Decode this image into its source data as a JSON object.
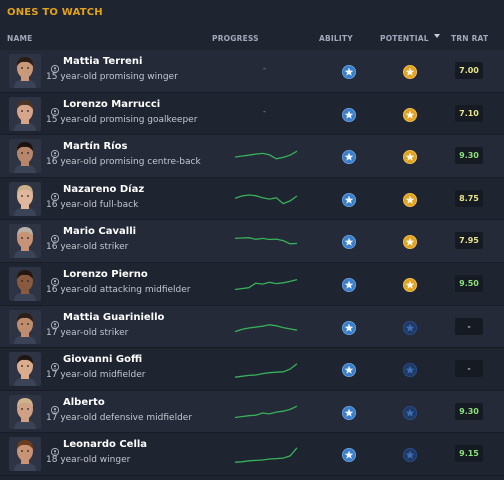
{
  "panel": {
    "title": "ONES TO WATCH"
  },
  "columns": {
    "name": "NAME",
    "progress": "PROGRESS",
    "ability": "ABILITY",
    "potential": "POTENTIAL",
    "trn_rat": "TRN RAT"
  },
  "colors": {
    "title": "#e2a21b",
    "ability_star_bg": "#3a7ec9",
    "potential_gold_bg": "#e0a322",
    "potential_dark_bg": "#203a66",
    "sparkline": "#37b15a"
  },
  "players": [
    {
      "name": "Mattia Terreni",
      "desc": "15 year-old promising winger",
      "progress_text": "-",
      "progress": null,
      "ability": "star-icon",
      "potential": "gold-star-icon",
      "trn_rat": "7.00",
      "trn_color": "yellow"
    },
    {
      "name": "Lorenzo Marrucci",
      "desc": "15 year-old promising goalkeeper",
      "progress_text": "-",
      "progress": null,
      "ability": "star-icon",
      "potential": "gold-star-icon",
      "trn_rat": "7.10",
      "trn_color": "yellow"
    },
    {
      "name": "Martín Ríos",
      "desc": "16 year-old promising centre-back",
      "progress_text": "",
      "progress": [
        0.5,
        0.55,
        0.6,
        0.66,
        0.7,
        0.62,
        0.4,
        0.48,
        0.6,
        0.82
      ],
      "ability": "star-icon",
      "potential": "gold-star-icon",
      "trn_rat": "9.30",
      "trn_color": "green"
    },
    {
      "name": "Nazareno Díaz",
      "desc": "16 year-old full-back",
      "progress_text": "",
      "progress": [
        0.6,
        0.72,
        0.78,
        0.74,
        0.62,
        0.55,
        0.62,
        0.3,
        0.45,
        0.72
      ],
      "ability": "star-icon",
      "potential": "gold-star-icon",
      "trn_rat": "8.75",
      "trn_color": "yellow"
    },
    {
      "name": "Mario Cavalli",
      "desc": "16 year-old striker",
      "progress_text": "",
      "progress": [
        0.7,
        0.72,
        0.74,
        0.65,
        0.7,
        0.64,
        0.66,
        0.58,
        0.4,
        0.42
      ],
      "ability": "star-icon",
      "potential": "gold-star-icon",
      "trn_rat": "7.95",
      "trn_color": "yellow"
    },
    {
      "name": "Lorenzo Pierno",
      "desc": "16 year-old attacking midfielder",
      "progress_text": "",
      "progress": [
        0.25,
        0.3,
        0.35,
        0.6,
        0.55,
        0.65,
        0.58,
        0.62,
        0.7,
        0.8
      ],
      "ability": "star-icon",
      "potential": "gold-star-icon",
      "trn_rat": "9.50",
      "trn_color": "green"
    },
    {
      "name": "Mattia Guariniello",
      "desc": "17 year-old striker",
      "progress_text": "",
      "progress": [
        0.3,
        0.42,
        0.5,
        0.55,
        0.6,
        0.68,
        0.62,
        0.52,
        0.45,
        0.38
      ],
      "ability": "star-icon",
      "potential": "dark-star-icon",
      "trn_rat": "-",
      "trn_color": "none"
    },
    {
      "name": "Giovanni Goffi",
      "desc": "17 year-old midfielder",
      "progress_text": "",
      "progress": [
        0.1,
        0.15,
        0.2,
        0.22,
        0.3,
        0.35,
        0.38,
        0.4,
        0.55,
        0.85
      ],
      "ability": "star-icon",
      "potential": "dark-star-icon",
      "trn_rat": "-",
      "trn_color": "none"
    },
    {
      "name": "Alberto",
      "desc": "17 year-old defensive midfielder",
      "progress_text": "",
      "progress": [
        0.25,
        0.3,
        0.35,
        0.38,
        0.5,
        0.45,
        0.55,
        0.6,
        0.7,
        0.88
      ],
      "ability": "star-icon",
      "potential": "dark-star-icon",
      "trn_rat": "9.30",
      "trn_color": "green"
    },
    {
      "name": "Leonardo Cella",
      "desc": "18 year-old winger",
      "progress_text": "",
      "progress": [
        0.1,
        0.12,
        0.18,
        0.2,
        0.22,
        0.28,
        0.3,
        0.33,
        0.45,
        0.9
      ],
      "ability": "star-icon",
      "potential": "dark-star-icon",
      "trn_rat": "9.15",
      "trn_color": "green"
    }
  ]
}
